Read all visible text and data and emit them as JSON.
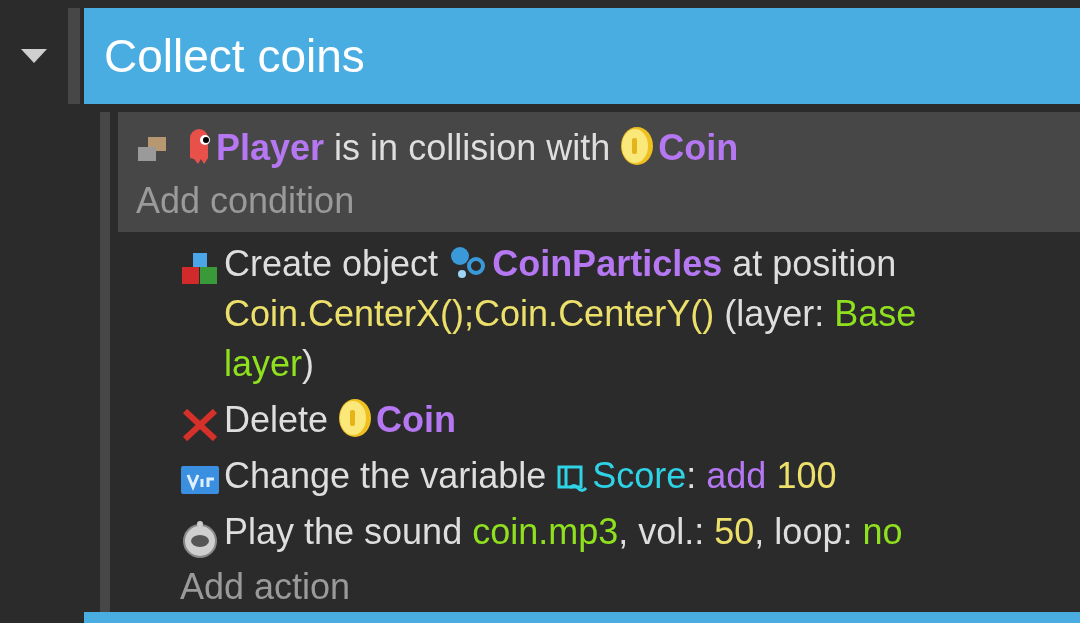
{
  "group": {
    "title": "Collect coins",
    "expanded": true
  },
  "conditions": [
    {
      "kind": "collision",
      "segments": [
        {
          "kind": "player",
          "text": "Player"
        },
        {
          "kind": "text",
          "text": "is in collision with"
        },
        {
          "kind": "coin",
          "text": "Coin"
        }
      ]
    }
  ],
  "add_condition": "Add condition",
  "actions": [
    {
      "kind": "create",
      "segments": [
        {
          "kind": "text",
          "text": "Create object"
        },
        {
          "kind": "particles",
          "text": "CoinParticles"
        },
        {
          "kind": "text",
          "text": "at position"
        },
        {
          "kind": "expression",
          "text": "Coin.CenterX();Coin.CenterY()"
        },
        {
          "kind": "text",
          "text": "(layer:"
        },
        {
          "kind": "string",
          "text": "Base"
        },
        {
          "kind": "string",
          "text": "layer"
        },
        {
          "kind": "text",
          "text": ")",
          "tight": true
        }
      ]
    },
    {
      "kind": "delete",
      "segments": [
        {
          "kind": "text",
          "text": "Delete"
        },
        {
          "kind": "coin",
          "text": "Coin"
        }
      ]
    },
    {
      "kind": "variable",
      "segments": [
        {
          "kind": "text",
          "text": "Change the variable"
        },
        {
          "kind": "score",
          "text": "Score"
        },
        {
          "kind": "text",
          "text": ":",
          "tight": true
        },
        {
          "kind": "operator",
          "text": "add"
        },
        {
          "kind": "number",
          "text": "100"
        }
      ]
    },
    {
      "kind": "sound",
      "segments": [
        {
          "kind": "text",
          "text": "Play the sound"
        },
        {
          "kind": "string",
          "text": "coin.mp3"
        },
        {
          "kind": "text",
          "text": ", vol.:",
          "tight": true
        },
        {
          "kind": "number",
          "text": "50"
        },
        {
          "kind": "text",
          "text": ", loop:",
          "tight": true
        },
        {
          "kind": "string",
          "text": "no"
        }
      ]
    }
  ],
  "add_action": "Add action"
}
